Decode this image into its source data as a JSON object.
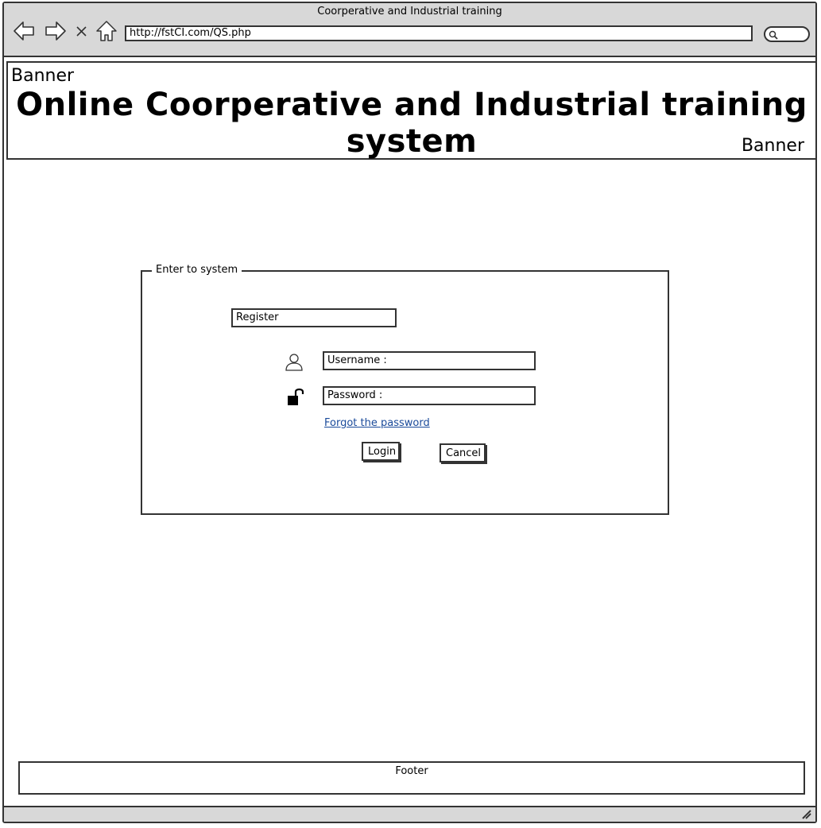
{
  "window": {
    "title": "Coorperative and Industrial training"
  },
  "browser": {
    "url": "http://fstCI.com/QS.php",
    "icons": [
      "back-arrow-icon",
      "forward-arrow-icon",
      "close-icon",
      "home-icon",
      "search-icon"
    ]
  },
  "banner": {
    "label_top": "Banner",
    "title": "Online Coorperative and Industrial training system",
    "label_bottom": "Banner"
  },
  "login_panel": {
    "legend": "Enter to system",
    "register_label": "Register",
    "username_placeholder": "Username :",
    "password_placeholder": "Password :",
    "forgot_link": "Forgot the password",
    "login_button": "Login",
    "cancel_button": "Cancel",
    "icons": [
      "user-icon",
      "unlock-icon"
    ]
  },
  "footer": {
    "label": "Footer"
  }
}
